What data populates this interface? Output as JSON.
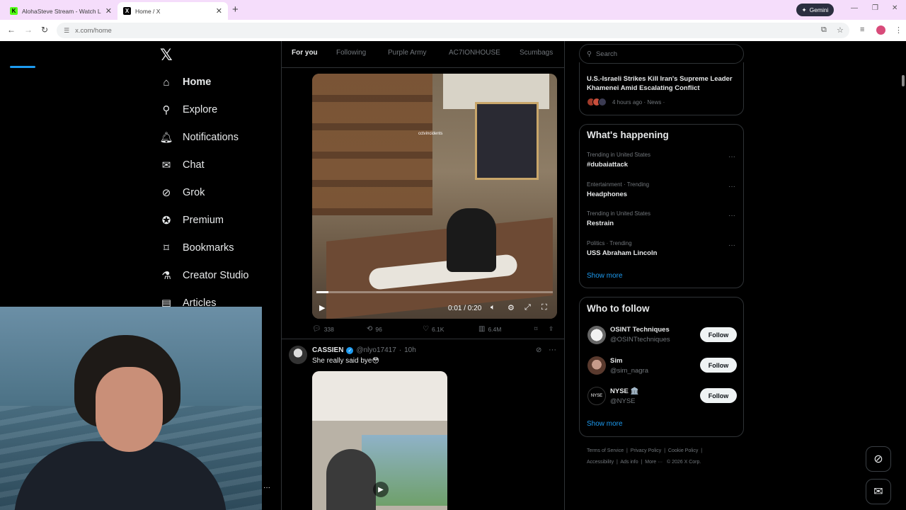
{
  "browser": {
    "tabs": [
      {
        "title": "AlohaSteve Stream - Watch Live",
        "favicon": "K",
        "favicon_color": "#53fc18"
      },
      {
        "title": "Home / X",
        "favicon": "X",
        "favicon_color": "#000000"
      }
    ],
    "gemini_label": "Gemini",
    "url": "x.com/home"
  },
  "nav": {
    "items": [
      {
        "label": "Home",
        "icon": "home-icon"
      },
      {
        "label": "Explore",
        "icon": "search-icon"
      },
      {
        "label": "Notifications",
        "icon": "bell-icon"
      },
      {
        "label": "Chat",
        "icon": "mail-icon"
      },
      {
        "label": "Grok",
        "icon": "grok-icon"
      },
      {
        "label": "Premium",
        "icon": "verified-icon"
      },
      {
        "label": "Bookmarks",
        "icon": "bookmark-icon"
      },
      {
        "label": "Creator Studio",
        "icon": "flask-icon"
      },
      {
        "label": "Articles",
        "icon": "article-icon"
      }
    ]
  },
  "feed": {
    "tabs": [
      "For you",
      "Following",
      "Purple Army",
      "AC7IONHOUSE",
      "Scumbags"
    ],
    "tweet1": {
      "video_time": "0:01 / 0:20",
      "video_progress": 0.05,
      "video_watermark": "cctvincidents",
      "replies": "338",
      "reposts": "96",
      "likes": "6.1K",
      "views": "6.4M"
    },
    "tweet2": {
      "name": "CASSIEN",
      "handle": "@nlyo17417",
      "time": "10h",
      "text": "She really said bye😳"
    }
  },
  "right": {
    "search_placeholder": "Search",
    "news": {
      "title": "U.S.-Israeli Strikes Kill Iran's Supreme Leader Khamenei Amid Escalating Conflict",
      "meta": "4 hours ago · News ·"
    },
    "happening": {
      "title": "What's happening",
      "trends": [
        {
          "meta": "Trending in United States",
          "name": "#dubaiattack"
        },
        {
          "meta": "Entertainment · Trending",
          "name": "Headphones"
        },
        {
          "meta": "Trending in United States",
          "name": "Restrain"
        },
        {
          "meta": "Politics · Trending",
          "name": "USS Abraham Lincoln"
        }
      ],
      "show_more": "Show more"
    },
    "who_to_follow": {
      "title": "Who to follow",
      "accounts": [
        {
          "name": "OSINT Techniques",
          "handle": "@OSINTtechniques",
          "button": "Follow"
        },
        {
          "name": "Sim",
          "handle": "@sim_nagra",
          "button": "Follow"
        },
        {
          "name": "NYSE 🏛️",
          "handle": "@NYSE",
          "button": "Follow"
        }
      ],
      "show_more": "Show more"
    },
    "footer": {
      "links": [
        "Terms of Service",
        "Privacy Policy",
        "Cookie Policy",
        "Accessibility",
        "Ads info",
        "More ···"
      ],
      "copyright": "© 2026 X Corp."
    }
  },
  "colors": {
    "accent": "#1d9bf0",
    "background": "#000000",
    "tabbar": "#f5ddfb"
  }
}
